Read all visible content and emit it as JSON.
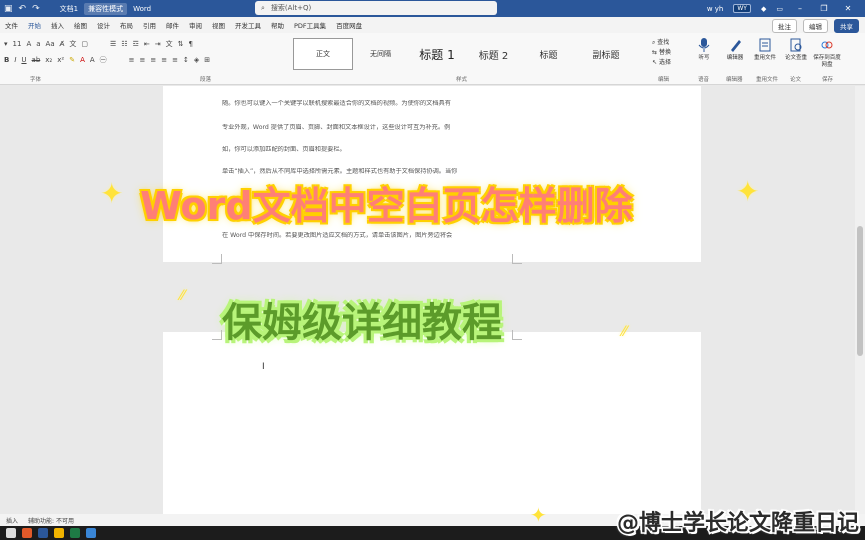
{
  "titlebar": {
    "doc_name": "文档1",
    "mode": "兼容性模式",
    "app": "Word",
    "search_placeholder": "搜索(Alt+Q)",
    "user": "w yh",
    "user_badge": "WY"
  },
  "tabs": [
    "文件",
    "开始",
    "插入",
    "绘图",
    "设计",
    "布局",
    "引用",
    "邮件",
    "审阅",
    "视图",
    "开发工具",
    "帮助",
    "PDF工具集",
    "百度网盘"
  ],
  "tabs_right": {
    "comments": "批注",
    "edit": "编辑",
    "share": "共享"
  },
  "ribbon": {
    "font_size": "11",
    "group_font": "字体",
    "group_paragraph": "段落",
    "group_styles": "样式",
    "styles": [
      "正文",
      "无间隔",
      "标题 1",
      "标题 2",
      "标题",
      "副标题"
    ],
    "editing": [
      "查找",
      "替换",
      "选择"
    ],
    "group_editing": "编辑",
    "big_buttons": [
      {
        "label": "听写",
        "group": "语音"
      },
      {
        "label": "编辑器",
        "group": "编辑器"
      },
      {
        "label": "重用文件",
        "group": "重用文件"
      },
      {
        "label": "论文查重",
        "group": "论文"
      },
      {
        "label": "保存到百度网盘",
        "group": "保存"
      }
    ]
  },
  "document": {
    "paragraphs": [
      "随。你也可以键入一个关键字以联机搜索最适合你的文档的视频。为使你的文档具有",
      "专业外观，Word 提供了页眉、页脚、封面和文本框设计，这些设计可互为补充。例",
      "如，你可以添加匹配的封面、页眉和提要栏。",
      "单击“插入”，然后从不同库中选择所需元素。主题和样式也有助于文档保持协调。当你",
      "在 Word 中保存时间。若要更改图片适应文档的方式，请单击该图片，图片旁边将会"
    ]
  },
  "overlay": {
    "title": "Word文档中空白页怎样删除",
    "subtitle": "保姆级详细教程",
    "watermark": "@博士学长论文降重日记"
  },
  "statusbar": {
    "mode": "插入",
    "accessibility": "辅助功能: 不可用"
  },
  "colors": {
    "accent": "#2b579a",
    "title_fill": "#ff7f76",
    "title_glow": "#ffd000",
    "subtitle_fill": "#5c9b2a",
    "subtitle_glow": "#b8f47a"
  }
}
